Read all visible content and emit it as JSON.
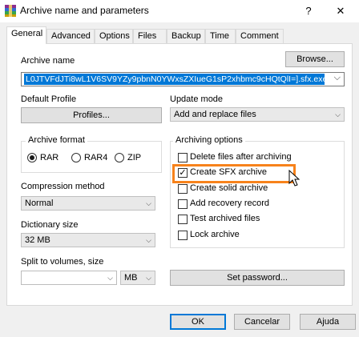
{
  "window": {
    "title": "Archive name and parameters",
    "help_glyph": "?",
    "close_glyph": "✕",
    "icon": "winrar-archive-icon"
  },
  "tabs": [
    {
      "label": "General",
      "active": true
    },
    {
      "label": "Advanced"
    },
    {
      "label": "Options"
    },
    {
      "label": "Files"
    },
    {
      "label": "Backup"
    },
    {
      "label": "Time"
    },
    {
      "label": "Comment"
    }
  ],
  "archive": {
    "label": "Archive name",
    "browse_label": "Browse...",
    "value": "L0JTVFdJTi8wL1V6SV9YZy9pbnN0YWxsZXIueG1sP2xhbmc9cHQtQlI=].sfx.exe"
  },
  "profile": {
    "label": "Default Profile",
    "button_label": "Profiles..."
  },
  "update_mode": {
    "label": "Update mode",
    "value": "Add and replace files"
  },
  "archive_format": {
    "label": "Archive format",
    "options": [
      {
        "label": "RAR",
        "checked": true
      },
      {
        "label": "RAR4",
        "checked": false
      },
      {
        "label": "ZIP",
        "checked": false
      }
    ]
  },
  "archiving_options": {
    "label": "Archiving options",
    "items": [
      {
        "label": "Delete files after archiving",
        "checked": false
      },
      {
        "label": "Create SFX archive",
        "checked": true
      },
      {
        "label": "Create solid archive",
        "checked": false
      },
      {
        "label": "Add recovery record",
        "checked": false
      },
      {
        "label": "Test archived files",
        "checked": false
      },
      {
        "label": "Lock archive",
        "checked": false
      }
    ]
  },
  "compression": {
    "label": "Compression method",
    "value": "Normal"
  },
  "dictionary": {
    "label": "Dictionary size",
    "value": "32 MB"
  },
  "split": {
    "label": "Split to volumes, size",
    "value": "",
    "unit": "MB"
  },
  "set_password_label": "Set password...",
  "footer": {
    "ok_label": "OK",
    "cancel_label": "Cancelar",
    "help_label": "Ajuda"
  },
  "colors": {
    "accent": "#0078d7",
    "highlight": "#f7821b"
  },
  "check_glyph": "✓",
  "arrow_glyph": "⌵"
}
